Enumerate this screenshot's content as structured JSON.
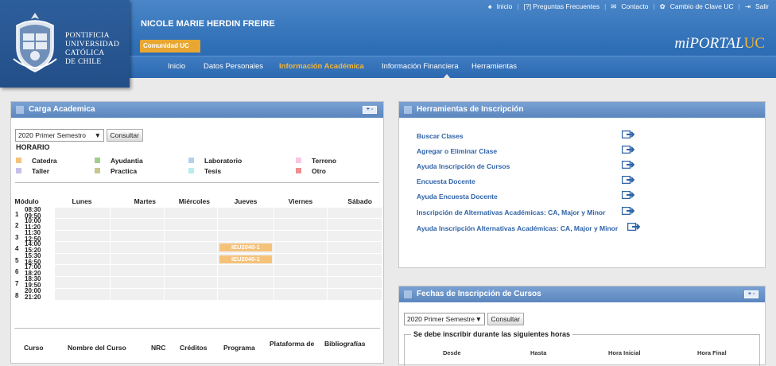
{
  "header": {
    "logo_lines": [
      "PONTIFICIA",
      "UNIVERSIDAD",
      "CATÓLICA",
      "DE CHILE"
    ],
    "user_name": "NICOLE MARIE HERDIN FREIRE",
    "comunidad": "Comunidad UC",
    "brand_prefix": "mi",
    "brand_mid": "PORTAL",
    "brand_suffix": "UC",
    "top_links": [
      "Inicio",
      "[?] Preguntas Frecuentes",
      "Contacto",
      "Cambio de Clave UC",
      "Salir"
    ],
    "nav": [
      "Inicio",
      "Datos Personales",
      "Información Académica",
      "Información Financiera",
      "Herramientas"
    ],
    "active_nav": "Información Académica",
    "colors": {
      "header": "#2f6fb6",
      "accent": "#f2b63a"
    }
  },
  "carga": {
    "title": "Carga Academica",
    "semester": "2020 Primer Semestro",
    "consultar": "Consultar",
    "horario": "HORARIO",
    "legend": [
      {
        "label": "Catedra",
        "color": "#f5c27a"
      },
      {
        "label": "Ayudantia",
        "color": "#9fd08a"
      },
      {
        "label": "Laboratorio",
        "color": "#b5d0ec"
      },
      {
        "label": "Terreno",
        "color": "#f7c6e6"
      },
      {
        "label": "Taller",
        "color": "#c7c0ea"
      },
      {
        "label": "Practica",
        "color": "#c8c78e"
      },
      {
        "label": "Tesis",
        "color": "#b9ecec"
      },
      {
        "label": "Otro",
        "color": "#ee8f8f"
      }
    ],
    "days": [
      "Módulo",
      "Lunes",
      "Martes",
      "Miércoles",
      "Jueves",
      "Viernes",
      "Sábado"
    ],
    "modules": [
      {
        "n": "1",
        "start": "08:30",
        "end": "09:50"
      },
      {
        "n": "2",
        "start": "10:00",
        "end": "11:20"
      },
      {
        "n": "3",
        "start": "11:30",
        "end": "12:50"
      },
      {
        "n": "4",
        "start": "14:00",
        "end": "15:20"
      },
      {
        "n": "5",
        "start": "15:30",
        "end": "16:50"
      },
      {
        "n": "6",
        "start": "17:00",
        "end": "18:20"
      },
      {
        "n": "7",
        "start": "18:30",
        "end": "19:50"
      },
      {
        "n": "8",
        "start": "20:00",
        "end": "21:20"
      }
    ],
    "course_code": "IEU2040-1",
    "course_cols": [
      "Curso",
      "Nombre del Curso",
      "NRC",
      "Créditos",
      "Programa",
      "Plataforma de",
      "Bibliografías"
    ]
  },
  "herramientas": {
    "title": "Herramientas de Inscripción",
    "items": [
      "Buscar Clases",
      "Agregar o Eliminar Clase",
      "Ayuda Inscripción de Cursos",
      "Encuesta Docente",
      "Ayuda Encuesta Docente",
      "Inscripción de Alternativas Académicas: CA, Major y Minor",
      "Ayuda Inscripción Alternativas Académicas: CA, Major y Minor"
    ]
  },
  "fechas": {
    "title": "Fechas de Inscripción de Cursos",
    "semester": "2020 Primer Semestre",
    "consultar": "Consultar",
    "legend_text": "Se debe inscribir durante las siguientes horas",
    "cols": [
      "Desde",
      "Hasta",
      "Hora Inicial",
      "Hora Final"
    ]
  }
}
